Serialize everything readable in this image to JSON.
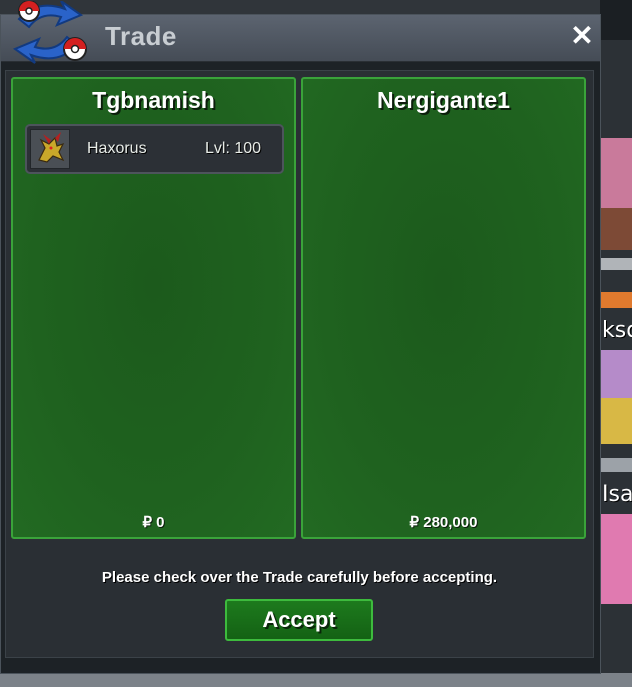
{
  "window": {
    "title": "Trade"
  },
  "trade": {
    "left": {
      "player": "Tgbnamish",
      "money": "₽ 0",
      "items": [
        {
          "name": "Haxorus",
          "level": "Lvl: 100"
        }
      ]
    },
    "right": {
      "player": "Nergigante1",
      "money": "₽ 280,000"
    },
    "notice": "Please check over the Trade carefully before accepting.",
    "accept_label": "Accept"
  },
  "background": {
    "partial_names": [
      "kso",
      "Isa"
    ]
  },
  "colors": {
    "panel_green": "#1f621f",
    "panel_border": "#3aa33a",
    "titlebar": "#4f5661",
    "accept_button": "#1a731a"
  },
  "icons": {
    "close": "close-icon",
    "logo": "trade-logo-icon",
    "pokemon": "haxorus-sprite"
  }
}
